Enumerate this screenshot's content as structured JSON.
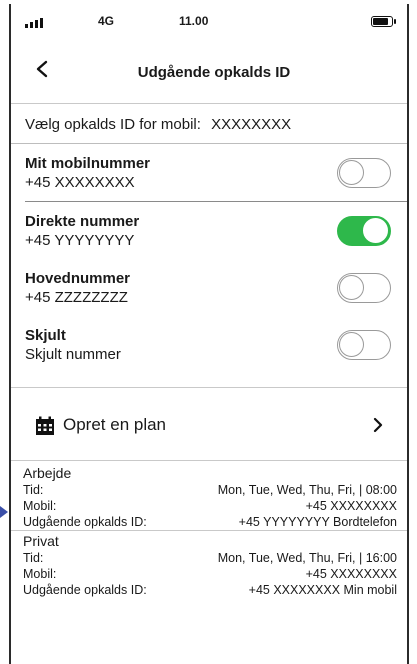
{
  "status_bar": {
    "network": "4G",
    "time": "11.00",
    "battery_fraction": 0.85
  },
  "nav": {
    "title": "Udgående opkalds ID"
  },
  "caller_id": {
    "label": "Vælg opkalds ID for mobil:",
    "value": "XXXXXXXX"
  },
  "options": [
    {
      "title": "Mit mobilnummer",
      "subtitle": "+45  XXXXXXXX",
      "enabled": false
    },
    {
      "title": "Direkte nummer",
      "subtitle": "+45  YYYYYYYY",
      "enabled": true
    },
    {
      "title": "Hovednummer",
      "subtitle": "+45  ZZZZZZZZ",
      "enabled": false
    },
    {
      "title": "Skjult",
      "subtitle": "Skjult nummer",
      "enabled": false
    }
  ],
  "plan": {
    "label": "Opret en plan",
    "icon": "calendar-icon",
    "chevron": "chevron-right-icon"
  },
  "schedules": [
    {
      "name": "Arbejde",
      "time_label": "Tid:",
      "time_value": "Mon, Tue, Wed, Thu, Fri,  | 08:00",
      "mobile_label": "Mobil:",
      "mobile_value": "+45  XXXXXXXX",
      "id_label": "Udgående opkalds ID:",
      "id_value": "+45  YYYYYYYY Bordtelefon"
    },
    {
      "name": "Privat",
      "time_label": "Tid:",
      "time_value": "Mon, Tue, Wed, Thu, Fri,  | 16:00",
      "mobile_label": "Mobil:",
      "mobile_value": "+45  XXXXXXXX",
      "id_label": "Udgående opkalds ID:",
      "id_value": "+45  XXXXXXXX  Min mobil"
    }
  ],
  "colors": {
    "toggle_on": "#2eb84b",
    "toggle_off_border": "#9a9a9a",
    "text": "#1a1a1a"
  }
}
